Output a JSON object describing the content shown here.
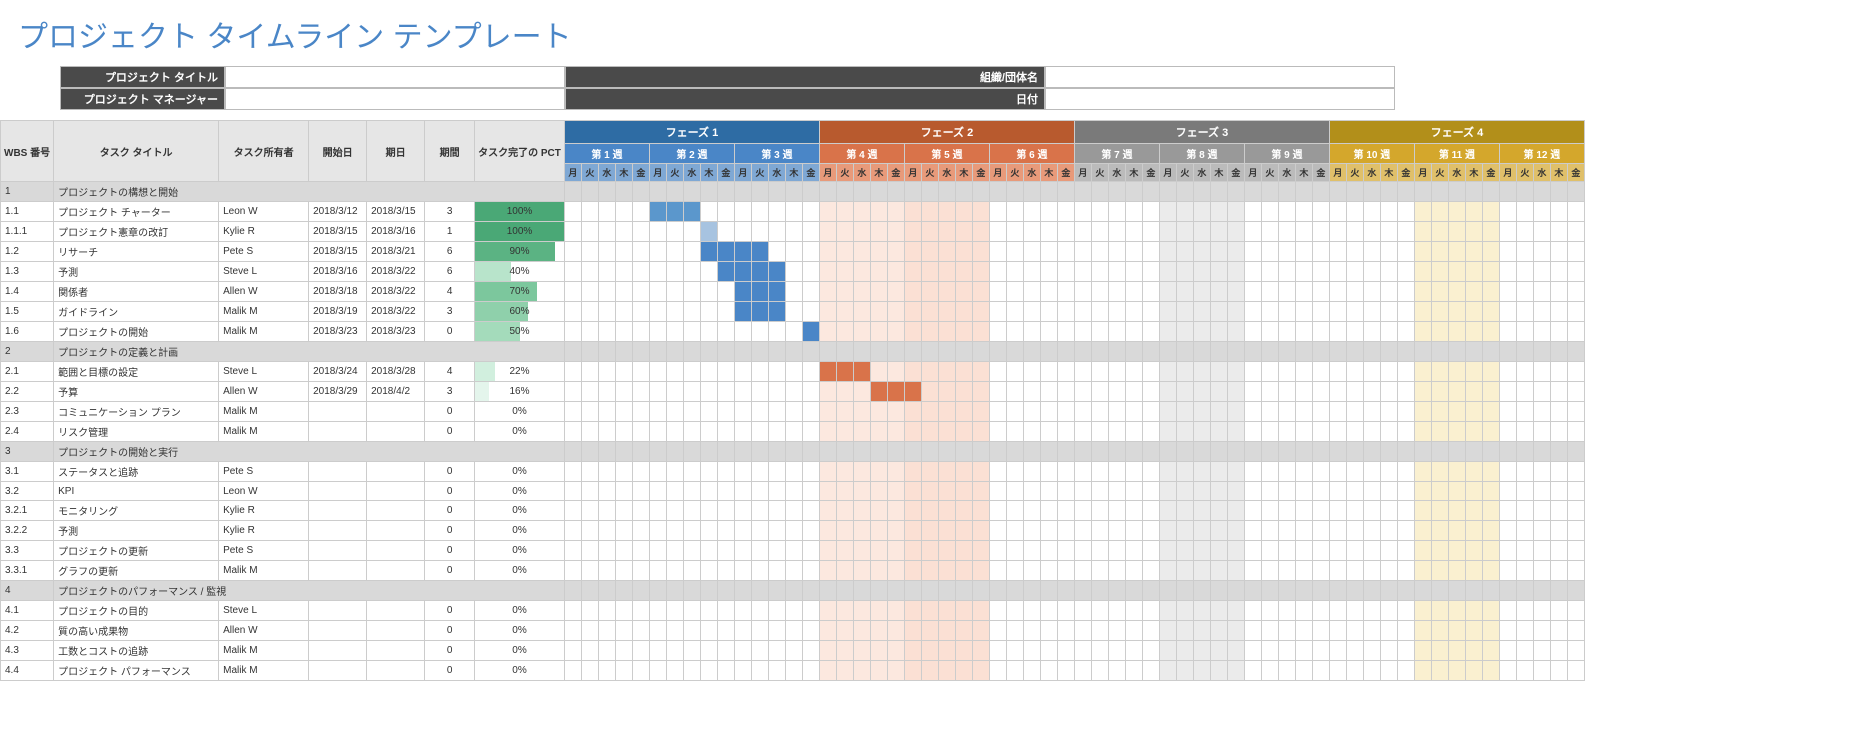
{
  "title": "プロジェクト タイムライン テンプレート",
  "meta": {
    "projectTitleLabel": "プロジェクト タイトル",
    "projectTitleValue": "",
    "orgLabel": "組織/団体名",
    "orgValue": "",
    "pmLabel": "プロジェクト マネージャー",
    "pmValue": "",
    "dateLabel": "日付",
    "dateValue": ""
  },
  "columns": {
    "wbs": "WBS 番号",
    "task": "タスク タイトル",
    "owner": "タスク所有者",
    "start": "開始日",
    "end": "期日",
    "duration": "期間",
    "pct": "タスク完了の PCT"
  },
  "phases": [
    {
      "label": "フェーズ 1",
      "dark": "p1-dark",
      "med": "p1-med",
      "light": "p1-light",
      "weeks": [
        "第 1 週",
        "第 2 週",
        "第 3 週"
      ]
    },
    {
      "label": "フェーズ 2",
      "dark": "p2-dark",
      "med": "p2-med",
      "light": "p2-light",
      "weeks": [
        "第 4 週",
        "第 5 週",
        "第 6 週"
      ]
    },
    {
      "label": "フェーズ 3",
      "dark": "p3-dark",
      "med": "p3-med",
      "light": "p3-light",
      "weeks": [
        "第 7 週",
        "第 8 週",
        "第 9 週"
      ]
    },
    {
      "label": "フェーズ 4",
      "dark": "p4-dark",
      "med": "p4-med",
      "light": "p4-light",
      "weeks": [
        "第 10 週",
        "第 11 週",
        "第 12 週"
      ]
    }
  ],
  "days": [
    "月",
    "火",
    "水",
    "木",
    "金"
  ],
  "rows": [
    {
      "wbs": "1",
      "task": "プロジェクトの構想と開始",
      "section": true
    },
    {
      "wbs": "1.1",
      "task": "プロジェクト チャーター",
      "owner": "Leon W",
      "start": "2018/3/12",
      "end": "2018/3/15",
      "dur": "3",
      "pct": 100,
      "bar": [
        5,
        3,
        "#5b97cc"
      ]
    },
    {
      "wbs": "1.1.1",
      "task": "プロジェクト憲章の改訂",
      "owner": "Kylie R",
      "start": "2018/3/15",
      "end": "2018/3/16",
      "dur": "1",
      "pct": 100,
      "bar": [
        8,
        1,
        "#a7c3e0"
      ]
    },
    {
      "wbs": "1.2",
      "task": "リサーチ",
      "owner": "Pete S",
      "start": "2018/3/15",
      "end": "2018/3/21",
      "dur": "6",
      "pct": 90,
      "bar": [
        8,
        4,
        "#4a86c7"
      ]
    },
    {
      "wbs": "1.3",
      "task": "予測",
      "owner": "Steve L",
      "start": "2018/3/16",
      "end": "2018/3/22",
      "dur": "6",
      "pct": 40,
      "bar": [
        9,
        4,
        "#4a86c7"
      ]
    },
    {
      "wbs": "1.4",
      "task": "関係者",
      "owner": "Allen W",
      "start": "2018/3/18",
      "end": "2018/3/22",
      "dur": "4",
      "pct": 70,
      "bar": [
        10,
        3,
        "#4a86c7"
      ]
    },
    {
      "wbs": "1.5",
      "task": "ガイドライン",
      "owner": "Malik M",
      "start": "2018/3/19",
      "end": "2018/3/22",
      "dur": "3",
      "pct": 60,
      "bar": [
        10,
        3,
        "#4a86c7"
      ]
    },
    {
      "wbs": "1.6",
      "task": "プロジェクトの開始",
      "owner": "Malik M",
      "start": "2018/3/23",
      "end": "2018/3/23",
      "dur": "0",
      "pct": 50,
      "bar": [
        14,
        1,
        "#4a86c7"
      ]
    },
    {
      "wbs": "2",
      "task": "プロジェクトの定義と計画",
      "section": true
    },
    {
      "wbs": "2.1",
      "task": "範囲と目標の設定",
      "owner": "Steve L",
      "start": "2018/3/24",
      "end": "2018/3/28",
      "dur": "4",
      "pct": 22,
      "bar": [
        15,
        3,
        "#d9734a"
      ]
    },
    {
      "wbs": "2.2",
      "task": "予算",
      "owner": "Allen W",
      "start": "2018/3/29",
      "end": "2018/4/2",
      "dur": "3",
      "pct": 16,
      "bar": [
        18,
        3,
        "#d9734a"
      ]
    },
    {
      "wbs": "2.3",
      "task": "コミュニケーション プラン",
      "owner": "Malik M",
      "start": "",
      "end": "",
      "dur": "0",
      "pct": 0
    },
    {
      "wbs": "2.4",
      "task": "リスク管理",
      "owner": "Malik M",
      "start": "",
      "end": "",
      "dur": "0",
      "pct": 0
    },
    {
      "wbs": "3",
      "task": "プロジェクトの開始と実行",
      "section": true
    },
    {
      "wbs": "3.1",
      "task": "ステータスと追跡",
      "owner": "Pete S",
      "start": "",
      "end": "",
      "dur": "0",
      "pct": 0
    },
    {
      "wbs": "3.2",
      "task": "KPI",
      "owner": "Leon W",
      "start": "",
      "end": "",
      "dur": "0",
      "pct": 0
    },
    {
      "wbs": "3.2.1",
      "task": "モニタリング",
      "owner": "Kylie R",
      "start": "",
      "end": "",
      "dur": "0",
      "pct": 0
    },
    {
      "wbs": "3.2.2",
      "task": "予測",
      "owner": "Kylie R",
      "start": "",
      "end": "",
      "dur": "0",
      "pct": 0
    },
    {
      "wbs": "3.3",
      "task": "プロジェクトの更新",
      "owner": "Pete S",
      "start": "",
      "end": "",
      "dur": "0",
      "pct": 0
    },
    {
      "wbs": "3.3.1",
      "task": "グラフの更新",
      "owner": "Malik M",
      "start": "",
      "end": "",
      "dur": "0",
      "pct": 0
    },
    {
      "wbs": "4",
      "task": "プロジェクトのパフォーマンス / 監視",
      "section": true
    },
    {
      "wbs": "4.1",
      "task": "プロジェクトの目的",
      "owner": "Steve L",
      "start": "",
      "end": "",
      "dur": "0",
      "pct": 0
    },
    {
      "wbs": "4.2",
      "task": "質の高い成果物",
      "owner": "Allen W",
      "start": "",
      "end": "",
      "dur": "0",
      "pct": 0
    },
    {
      "wbs": "4.3",
      "task": "工数とコストの追跡",
      "owner": "Malik M",
      "start": "",
      "end": "",
      "dur": "0",
      "pct": 0
    },
    {
      "wbs": "4.4",
      "task": "プロジェクト パフォーマンス",
      "owner": "Malik M",
      "start": "",
      "end": "",
      "dur": "0",
      "pct": 0
    }
  ],
  "weekBg": {
    "3": "w4-bg",
    "4": "w5-bg",
    "7": "w8-bg",
    "10": "w11-bg"
  }
}
